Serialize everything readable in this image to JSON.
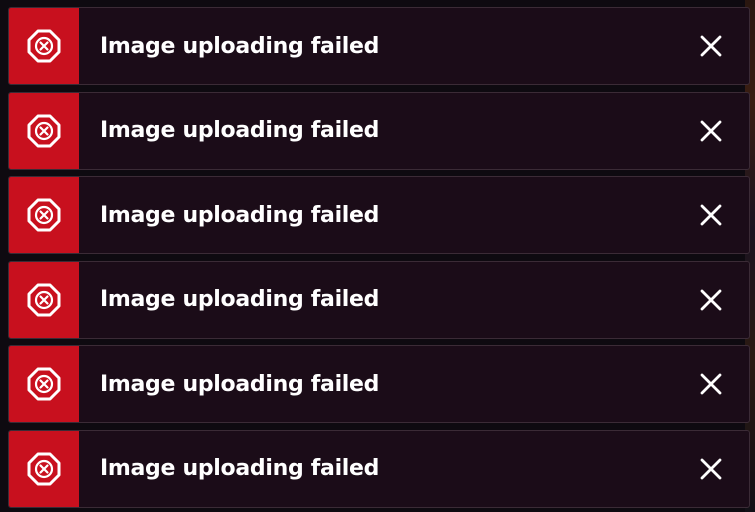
{
  "notifications": [
    {
      "message": "Image uploading failed",
      "type": "error",
      "icon": "error-octagon-icon",
      "close_icon": "close-icon"
    },
    {
      "message": "Image uploading failed",
      "type": "error",
      "icon": "error-octagon-icon",
      "close_icon": "close-icon"
    },
    {
      "message": "Image uploading failed",
      "type": "error",
      "icon": "error-octagon-icon",
      "close_icon": "close-icon"
    },
    {
      "message": "Image uploading failed",
      "type": "error",
      "icon": "error-octagon-icon",
      "close_icon": "close-icon"
    },
    {
      "message": "Image uploading failed",
      "type": "error",
      "icon": "error-octagon-icon",
      "close_icon": "close-icon"
    },
    {
      "message": "Image uploading failed",
      "type": "error",
      "icon": "error-octagon-icon",
      "close_icon": "close-icon"
    }
  ],
  "colors": {
    "error_accent": "#c8101e",
    "toast_background": "#1b0c18",
    "text": "#ffffff"
  }
}
